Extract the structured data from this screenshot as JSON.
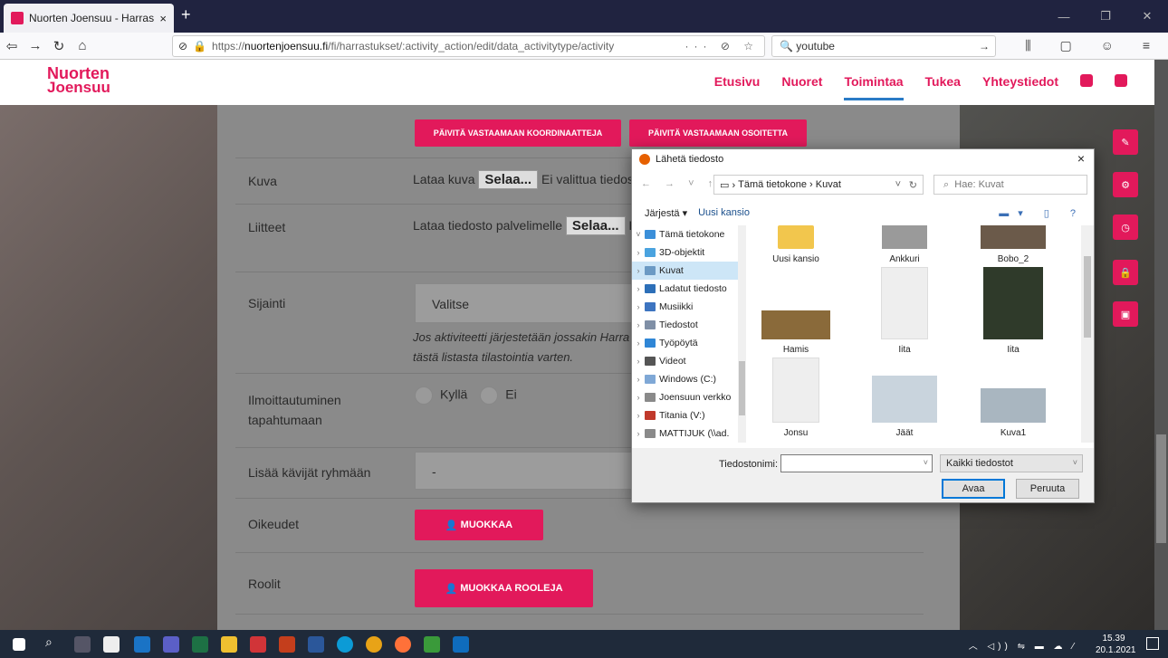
{
  "browser": {
    "tab_title": "Nuorten Joensuu - Harrastusha",
    "tab_close": "×",
    "new_tab": "+",
    "url_plain": "https://",
    "url_domain": "nuortenjoensuu.fi",
    "url_path": "/fi/harrastukset/:activity_action/edit/data_activitytype/activity",
    "url_icons": "··· ⊘ ☆",
    "search_value": "youtube",
    "search_arrow": "→"
  },
  "site": {
    "logo_line1": "Nuorten",
    "logo_line2": "Joensuu",
    "menu": [
      "Etusivu",
      "Nuoret",
      "Toimintaa",
      "Tukea",
      "Yhteystiedot"
    ],
    "active_menu": "Toimintaa"
  },
  "form": {
    "btn_coords": "PÄIVITÄ VASTAAMAAN KOORDINAATTEJA",
    "btn_address": "PÄIVITÄ VASTAAMAAN OSOITETTA",
    "kuva_label": "Kuva",
    "kuva_prefix": "Lataa kuva",
    "browse": "Selaa...",
    "kuva_none": "Ei valittua tiedosto",
    "liitteet_label": "Liitteet",
    "liitteet_prefix": "Lataa tiedosto palvelimelle",
    "liitteet_none": "Ei",
    "sijainti_label": "Sijainti",
    "sijainti_select": "Valitse",
    "sijainti_help1": "Jos aktiviteetti järjestetään jossakin Harra",
    "sijainti_help2": "tästä listasta tilastointia varten.",
    "ilmo_label1": "Ilmoittautuminen",
    "ilmo_label2": "tapahtumaan",
    "yes": "Kyllä",
    "no": "Ei",
    "group_label": "Lisää kävijät ryhmään",
    "group_value": "-",
    "rights_label": "Oikeudet",
    "rights_btn": "MUOKKAA",
    "roles_label": "Roolit",
    "roles_btn": "MUOKKAA ROOLEJA"
  },
  "dialog": {
    "title": "Lähetä tiedosto",
    "close": "×",
    "path_parts": [
      "Tämä tietokone",
      "Kuvat"
    ],
    "search_placeholder": "Hae: Kuvat",
    "organize": "Järjestä ▾",
    "new_folder": "Uusi kansio",
    "tree": [
      {
        "label": "Tämä tietokone",
        "color": "#3b8fd9"
      },
      {
        "label": "3D-objektit",
        "color": "#4aa3df"
      },
      {
        "label": "Kuvat",
        "color": "#6b9ac4"
      },
      {
        "label": "Ladatut tiedosto",
        "color": "#2d6fb8"
      },
      {
        "label": "Musiikki",
        "color": "#3d74c0"
      },
      {
        "label": "Tiedostot",
        "color": "#7f8fa6"
      },
      {
        "label": "Työpöytä",
        "color": "#2f86d6"
      },
      {
        "label": "Videot",
        "color": "#555"
      },
      {
        "label": "Windows (C:)",
        "color": "#7fa8d6"
      },
      {
        "label": "Joensuun verkko",
        "color": "#8a8a8a"
      },
      {
        "label": "Titania (V:)",
        "color": "#c0392b"
      },
      {
        "label": "MATTIJUK (\\\\ad.",
        "color": "#8a8a8a"
      }
    ],
    "files": [
      "Uusi kansio",
      "Ankkuri",
      "Bobo_2",
      "Hamis",
      "Iita",
      "Iita",
      "Jonsu",
      "Jäät",
      "Kuva1"
    ],
    "filename_label": "Tiedostonimi:",
    "filename_value": "",
    "filetype": "Kaikki tiedostot",
    "open_btn": "Avaa",
    "cancel_btn": "Peruuta"
  },
  "taskbar": {
    "time": "15.39",
    "date": "20.1.2021"
  }
}
